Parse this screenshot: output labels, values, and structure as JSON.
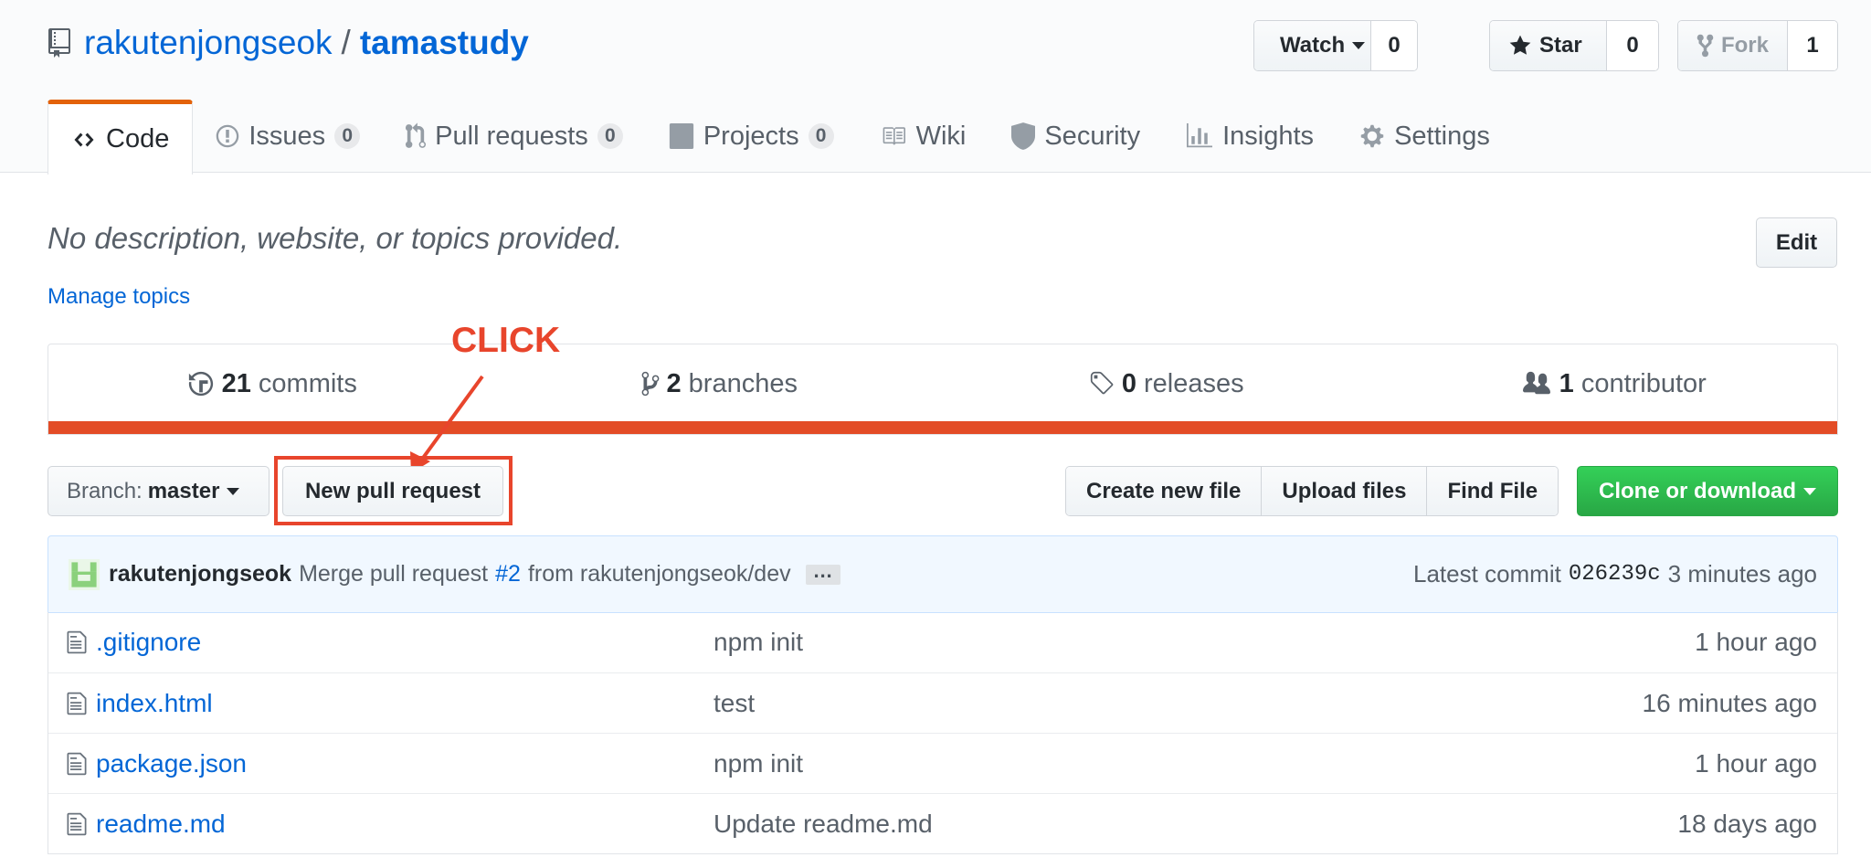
{
  "repo": {
    "owner": "rakutenjongseok",
    "separator": "/",
    "name": "tamastudy"
  },
  "social": {
    "watch_label": "Watch",
    "watch_count": "0",
    "star_label": "Star",
    "star_count": "0",
    "fork_label": "Fork",
    "fork_count": "1"
  },
  "tabs": [
    {
      "label": "Code",
      "icon": "code-icon",
      "selected": true
    },
    {
      "label": "Issues",
      "count": "0",
      "icon": "issue-icon"
    },
    {
      "label": "Pull requests",
      "count": "0",
      "icon": "pull-request-icon"
    },
    {
      "label": "Projects",
      "count": "0",
      "icon": "project-icon"
    },
    {
      "label": "Wiki",
      "icon": "book-icon"
    },
    {
      "label": "Security",
      "icon": "shield-icon"
    },
    {
      "label": "Insights",
      "icon": "graph-icon"
    },
    {
      "label": "Settings",
      "icon": "gear-icon"
    }
  ],
  "description": "No description, website, or topics provided.",
  "edit_label": "Edit",
  "manage_topics": "Manage topics",
  "summary": {
    "commits_count": "21",
    "commits_label": "commits",
    "branches_count": "2",
    "branches_label": "branches",
    "releases_count": "0",
    "releases_label": "releases",
    "contributors_count": "1",
    "contributors_label": "contributor"
  },
  "annotation": {
    "label": "CLICK",
    "color": "#e8452c"
  },
  "branch": {
    "prefix": "Branch:",
    "name": "master"
  },
  "new_pull_request": "New pull request",
  "file_actions": [
    "Create new file",
    "Upload files",
    "Find File"
  ],
  "clone_label": "Clone or download",
  "commit": {
    "author": "rakutenjongseok",
    "message_pre": "Merge pull request",
    "pr_link": "#2",
    "message_post": "from rakutenjongseok/dev",
    "ellipsis": "…",
    "latest_label": "Latest commit",
    "sha": "026239c",
    "age": "3 minutes ago"
  },
  "files": [
    {
      "name": ".gitignore",
      "message": "npm init",
      "age": "1 hour ago"
    },
    {
      "name": "index.html",
      "message": "test",
      "age": "16 minutes ago"
    },
    {
      "name": "package.json",
      "message": "npm init",
      "age": "1 hour ago"
    },
    {
      "name": "readme.md",
      "message": "Update readme.md",
      "age": "18 days ago"
    }
  ],
  "colors": {
    "link": "#0366d6",
    "lang_bar": "#e34c26",
    "tab_accent": "#e36209",
    "clone_green": "#28a745"
  }
}
